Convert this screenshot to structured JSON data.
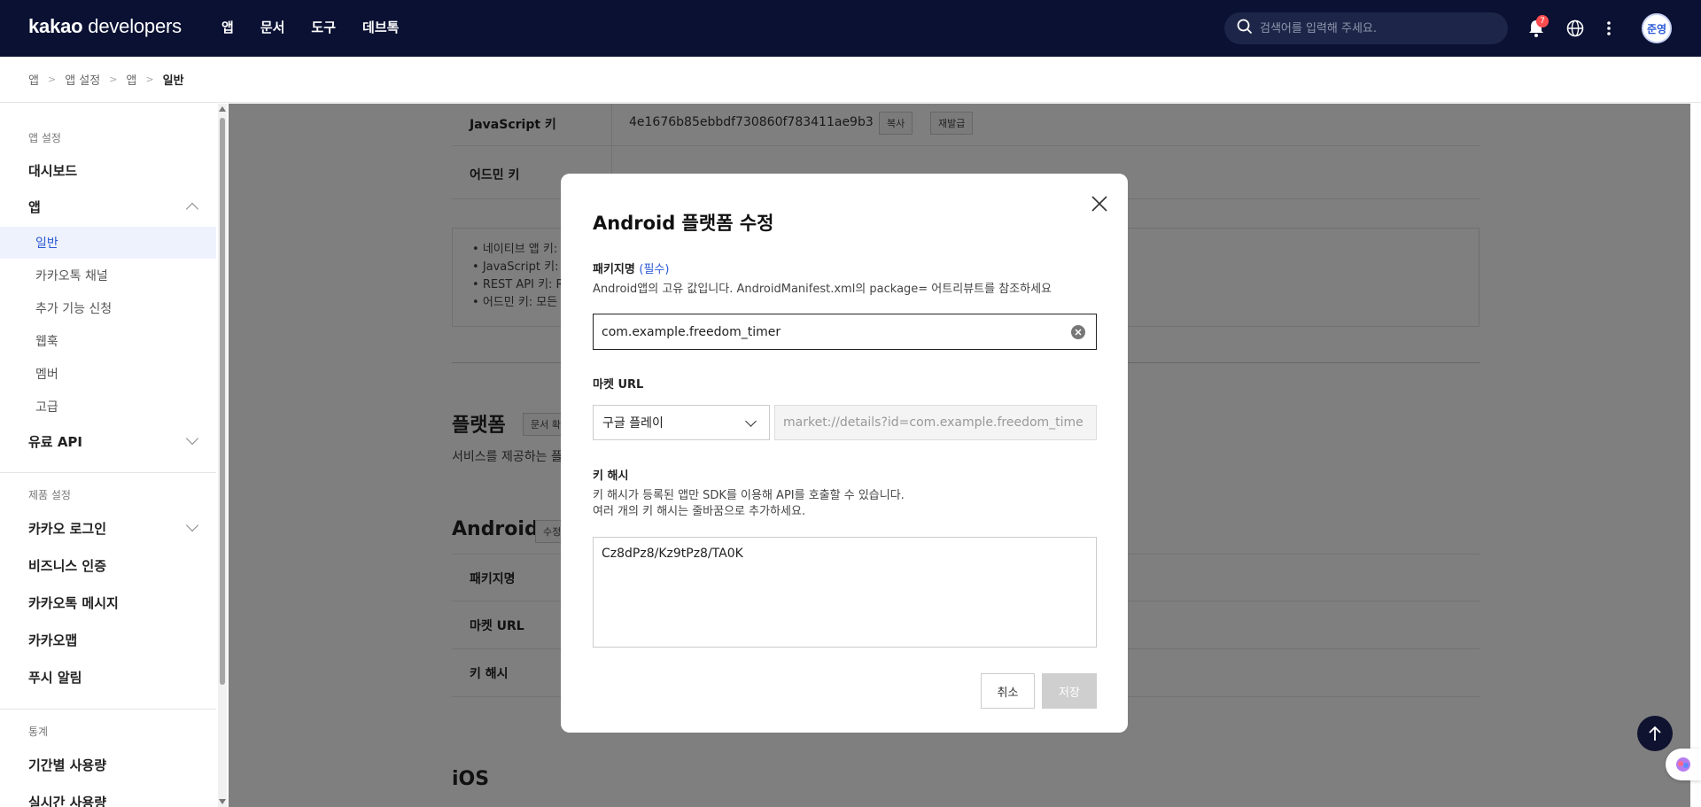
{
  "header": {
    "logo_bold": "kakao",
    "logo_rest": " developers",
    "nav": [
      "앱",
      "문서",
      "도구",
      "데브톡"
    ],
    "search_placeholder": "검색어를 입력해 주세요.",
    "notification_count": "7",
    "avatar_text": "준영"
  },
  "breadcrumb": [
    "앱",
    "앱 설정",
    "앱",
    "일반"
  ],
  "sidebar": {
    "section_app": "앱 설정",
    "dashboard": "대시보드",
    "app": "앱",
    "sub": [
      "일반",
      "카카오톡 채널",
      "추가 기능 신청",
      "웹훅",
      "멤버",
      "고급"
    ],
    "paid_api": "유료 API",
    "section_product": "제품 설정",
    "kakao_login": "카카오 로그인",
    "business_auth": "비즈니스 인증",
    "kakaotalk_message": "카카오톡 메시지",
    "kakao_moment": "카카오맵",
    "push": "푸시 알림",
    "section_stats": "통계",
    "period_usage": "기간별 사용량",
    "realtime_usage": "실시간 사용량"
  },
  "main": {
    "js_key_label": "JavaScript 키",
    "js_key_value": "4e1676b85ebbdf730860f783411ae9b3",
    "copy_btn": "복사",
    "reissue_btn": "재발급",
    "admin_key_label": "어드민 키",
    "notices": [
      "네이티브 앱 키: ",
      "JavaScript 키: ",
      "REST API 키: R",
      "어드민 키: 모든"
    ],
    "platform_title": "플랫폼",
    "platform_doc_btn": "문서 확",
    "platform_desc": "서비스를 제공하는 플",
    "android_title": "Android",
    "android_edit_btn": "수정",
    "android_rows": [
      "패키지명",
      "마켓 URL",
      "키 해시"
    ],
    "ios_title": "iOS"
  },
  "modal": {
    "title": "Android 플랫폼 수정",
    "package_label": "패키지명",
    "package_required": "(필수)",
    "package_desc": "Android앱의 고유 값입니다. AndroidManifest.xml의 package= 어트리뷰트를 참조하세요",
    "package_value": "com.example.freedom_timer",
    "market_label": "마켓 URL",
    "market_select": "구글 플레이",
    "market_value": "market://details?id=com.example.freedom_timer",
    "keyhash_label": "키 해시",
    "keyhash_desc1": "키 해시가 등록된 앱만 SDK를 이용해 API를 호출할 수 있습니다.",
    "keyhash_desc2": "여러 개의 키 해시는 줄바꿈으로 추가하세요.",
    "keyhash_value": "Cz8dPz8/Kz9tPz8/TA0K",
    "cancel": "취소",
    "save": "저장"
  },
  "colors": {
    "header_bg": "#0a1133",
    "accent": "#2a59d6",
    "badge": "#ff4d4f"
  }
}
